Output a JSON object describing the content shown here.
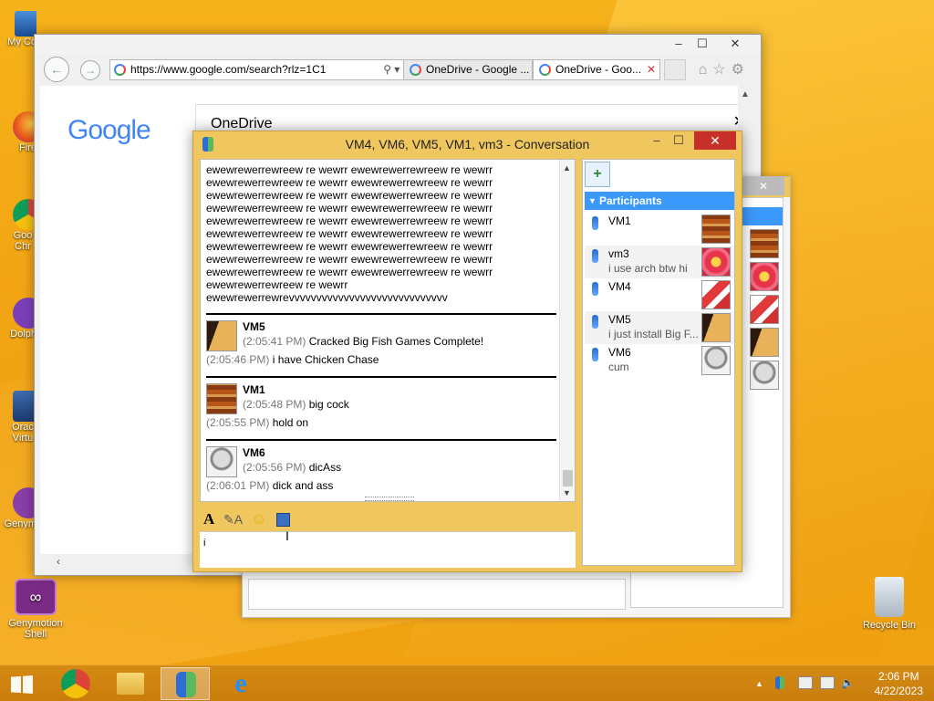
{
  "desktop": {
    "icons": [
      {
        "label": "My Co"
      },
      {
        "label": "Fire"
      },
      {
        "label": "Goo Chr"
      },
      {
        "label": "Dolph"
      },
      {
        "label": "Orac Virtu"
      },
      {
        "label": "Genym"
      }
    ],
    "genymotion_shell": "Genymotion Shell",
    "recycle_bin": "Recycle Bin"
  },
  "browser": {
    "address": "https://www.google.com/search?rlz=1C1",
    "tabs": [
      {
        "label": "OneDrive - Google ..."
      },
      {
        "label": "OneDrive - Goo..."
      }
    ],
    "google_logo": "Google",
    "onedrive_title": "OneDrive"
  },
  "conversation": {
    "title": "VM4, VM6, VM5, VM1, vm3 - Conversation",
    "spam_lines": [
      "ewewrewerrewreew re wewrr ewewrewerrewreew re wewrr",
      "ewewrewerrewreew re wewrr ewewrewerrewreew re wewrr",
      "ewewrewerrewreew re wewrr ewewrewerrewreew re wewrr",
      "ewewrewerrewreew re wewrr ewewrewerrewreew re wewrr",
      "ewewrewerrewreew re wewrr ewewrewerrewreew re wewrr",
      "ewewrewerrewreew re wewrr ewewrewerrewreew re wewrr",
      "ewewrewerrewreew re wewrr ewewrewerrewreew re wewrr",
      "ewewrewerrewreew re wewrr ewewrewerrewreew re wewrr",
      "ewewrewerrewreew re wewrr ewewrewerrewreew re wewrr",
      "ewewrewerrewreew re wewrr",
      "ewewrewerrewrevvvvvvvvvvvvvvvvvvvvvvvvvvvvv"
    ],
    "messages": [
      {
        "name": "VM5",
        "lines": [
          {
            "time": "(2:05:41 PM)",
            "text": "Cracked Big Fish Games Complete!"
          },
          {
            "time": "(2:05:46 PM)",
            "text": "i have Chicken Chase"
          }
        ]
      },
      {
        "name": "VM1",
        "lines": [
          {
            "time": "(2:05:48 PM)",
            "text": "big cock"
          },
          {
            "time": "(2:05:55 PM)",
            "text": "hold on"
          }
        ]
      },
      {
        "name": "VM6",
        "lines": [
          {
            "time": "(2:05:56 PM)",
            "text": "dicAss"
          },
          {
            "time": "(2:06:01 PM)",
            "text": "dick and ass"
          }
        ]
      }
    ],
    "input_value": "i",
    "participants_header": "Participants",
    "participants": [
      {
        "name": "VM1",
        "status": ""
      },
      {
        "name": "vm3",
        "status": "i use arch btw hi"
      },
      {
        "name": "VM4",
        "status": ""
      },
      {
        "name": "VM5",
        "status": "i just install Big F..."
      },
      {
        "name": "VM6",
        "status": "cum"
      }
    ]
  },
  "taskbar": {
    "time": "2:06 PM",
    "date": "4/22/2023"
  }
}
